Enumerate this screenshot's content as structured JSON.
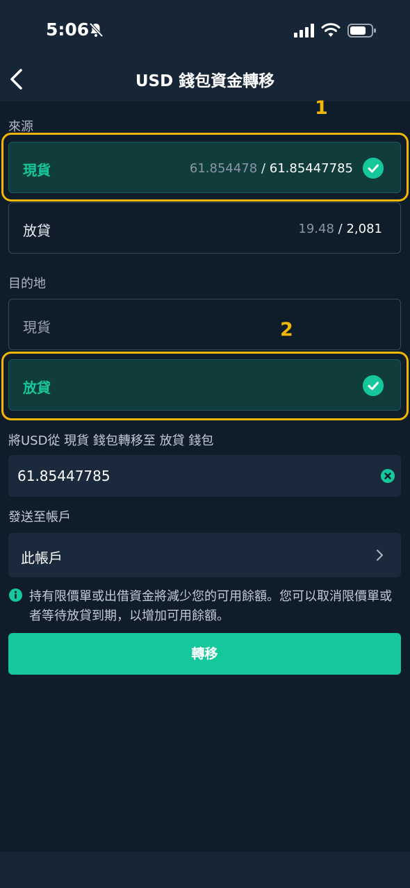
{
  "status_bar": {
    "time": "5:06"
  },
  "header": {
    "title": "USD 錢包資金轉移"
  },
  "source": {
    "label": "來源",
    "options": [
      {
        "name": "現貨",
        "available": "61.854478",
        "total": "61.85447785",
        "selected": true
      },
      {
        "name": "放貸",
        "available": "19.48",
        "total": "2,081",
        "selected": false
      }
    ]
  },
  "destination": {
    "label": "目的地",
    "options": [
      {
        "name": "現貨",
        "selected": false
      },
      {
        "name": "放貸",
        "selected": true
      }
    ]
  },
  "annotations": {
    "step1": "1",
    "step2": "2"
  },
  "transfer": {
    "description": "將USD從 現貨 錢包轉移至 放貸 錢包",
    "amount_value": "61.85447785"
  },
  "send_to": {
    "label": "發送至帳戶",
    "value": "此帳戶"
  },
  "info": {
    "text": "持有限價單或出借資金將減少您的可用餘額。您可以取消限價單或者等待放貸到期，以增加可用餘額。"
  },
  "actions": {
    "transfer_label": "轉移"
  },
  "colors": {
    "accent": "#15c79b",
    "highlight": "#f2b705",
    "background": "#0f1c29"
  },
  "icons": [
    "bell-off-icon",
    "signal-icon",
    "wifi-icon",
    "battery-icon",
    "back-icon",
    "check-icon",
    "clear-icon",
    "chevron-right-icon",
    "info-icon"
  ]
}
